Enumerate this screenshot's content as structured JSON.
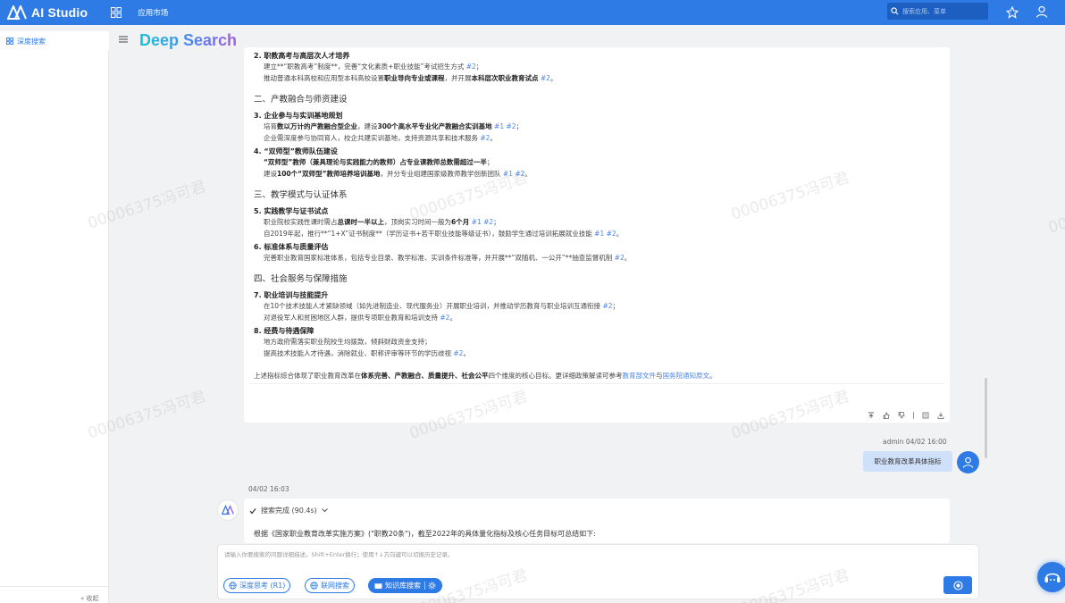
{
  "topbar": {
    "brand": "AI Studio",
    "app_market": "应用市场",
    "search_placeholder": "搜索应用、菜单"
  },
  "sidebar": {
    "items": [
      {
        "label": "深度搜索"
      }
    ],
    "collapse_label": "收起"
  },
  "header": {
    "title": "Deep Search"
  },
  "answer": {
    "items": [
      {
        "title": "2. 职教高考与高层次人才培养",
        "lines": [
          [
            {
              "t": "建立**“职教高考”制度**，完善“文化素质+职业技能”考试招生方式 "
            },
            {
              "t": "#2",
              "c": 1
            },
            {
              "t": "；"
            }
          ],
          [
            {
              "t": "推动普通本科高校和应用型本科高校设置"
            },
            {
              "t": "职业导向专业或课程",
              "b": 1
            },
            {
              "t": "，并开展"
            },
            {
              "t": "本科层次职业教育试点",
              "b": 1
            },
            {
              "t": " "
            },
            {
              "t": "#2",
              "c": 1
            },
            {
              "t": "。"
            }
          ]
        ]
      },
      {
        "section": "二、产教融合与师资建设"
      },
      {
        "title": "3. 企业参与与实训基地规划",
        "lines": [
          [
            {
              "t": "培育"
            },
            {
              "t": "数以万计的产教融合型企业",
              "b": 1
            },
            {
              "t": "，建设"
            },
            {
              "t": "300个高水平专业化产教融合实训基地",
              "b": 1
            },
            {
              "t": " "
            },
            {
              "t": "#1",
              "c": 1
            },
            {
              "t": " "
            },
            {
              "t": "#2",
              "c": 1
            },
            {
              "t": "；"
            }
          ],
          [
            {
              "t": "企业需深度参与协同育人，校企共建实训基地，支持资源共享和技术服务 "
            },
            {
              "t": "#2",
              "c": 1
            },
            {
              "t": "。"
            }
          ]
        ]
      },
      {
        "title": "4. “双师型”教师队伍建设",
        "lines": [
          [
            {
              "t": "“双师型”教师（兼具理论与实践能力的教师）占专业课教师总数需超过一半",
              "b": 1
            },
            {
              "t": "；"
            }
          ],
          [
            {
              "t": "建设"
            },
            {
              "t": "100个“双师型”教师培养培训基地",
              "b": 1
            },
            {
              "t": "，并分专业组建国家级教师教学创新团队 "
            },
            {
              "t": "#1",
              "c": 1
            },
            {
              "t": " "
            },
            {
              "t": "#2",
              "c": 1
            },
            {
              "t": "。"
            }
          ]
        ]
      },
      {
        "section": "三、教学模式与认证体系"
      },
      {
        "title": "5. 实践教学与证书试点",
        "lines": [
          [
            {
              "t": "职业院校实践性课时需占"
            },
            {
              "t": "总课时一半以上",
              "b": 1
            },
            {
              "t": "，顶岗实习时间一般为"
            },
            {
              "t": "6个月",
              "b": 1
            },
            {
              "t": " "
            },
            {
              "t": "#1",
              "c": 1
            },
            {
              "t": " "
            },
            {
              "t": "#2",
              "c": 1
            },
            {
              "t": "；"
            }
          ],
          [
            {
              "t": "自2019年起，推行**“1+X”证书制度**（学历证书+若干职业技能等级证书），鼓励学生通过培训拓展就业技能 "
            },
            {
              "t": "#1",
              "c": 1
            },
            {
              "t": " "
            },
            {
              "t": "#2",
              "c": 1
            },
            {
              "t": "。"
            }
          ]
        ]
      },
      {
        "title": "6. 标准体系与质量评估",
        "lines": [
          [
            {
              "t": "完善职业教育国家标准体系，包括专业目录、教学标准、实训条件标准等，并开展**“双随机、一公开”**抽查监督机制 "
            },
            {
              "t": "#2",
              "c": 1
            },
            {
              "t": "。"
            }
          ]
        ]
      },
      {
        "section": "四、社会服务与保障措施"
      },
      {
        "title": "7. 职业培训与技能提升",
        "lines": [
          [
            {
              "t": "在10个技术技能人才紧缺领域（如先进制造业、现代服务业）开展职业培训，并推动学历教育与职业培训互通衔接 "
            },
            {
              "t": "#2",
              "c": 1
            },
            {
              "t": "；"
            }
          ],
          [
            {
              "t": "对退役军人和贫困地区人群，提供专项职业教育和培训支持 "
            },
            {
              "t": "#2",
              "c": 1
            },
            {
              "t": "。"
            }
          ]
        ]
      },
      {
        "title": "8. 经费与待遇保障",
        "lines": [
          [
            {
              "t": "地方政府需落实职业院校生均拨款，倾斜财政资金支持；"
            }
          ],
          [
            {
              "t": "提高技术技能人才待遇，消除就业、职称评审等环节的学历歧视 "
            },
            {
              "t": "#2",
              "c": 1
            },
            {
              "t": "。"
            }
          ]
        ]
      }
    ],
    "summary": [
      {
        "t": "上述指标综合体现了职业教育改革在"
      },
      {
        "t": "体系完善、产教融合、质量提升、社会公平",
        "b": 1
      },
      {
        "t": "四个维度的核心目标。更详细政策解读可参考"
      },
      {
        "t": "教育部文件",
        "l": 1
      },
      {
        "t": "与"
      },
      {
        "t": "国务院通知原文",
        "l": 1
      },
      {
        "t": "。"
      }
    ]
  },
  "user_message": {
    "meta": "admin 04/02 16:00",
    "text": "职业教育改革具体指标"
  },
  "bot_reply": {
    "time": "04/02 16:03",
    "status": "搜索完成 (90.4s)",
    "text": "根据《国家职业教育改革实施方案》(\"职教20条\")，截至2022年的具体量化指标及核心任务目标可总结如下:"
  },
  "input": {
    "placeholder": "请输入你要搜索的问题详细描述。Shift+Enter换行；使用↑↓方向键可以切换历史记录。",
    "chips": {
      "deep_think": "深度思考 (R1)",
      "web_search": "联网搜索",
      "kb_search": "知识库搜索"
    }
  },
  "watermark": "00006375冯可君",
  "colors": {
    "primary": "#2f7be6",
    "citation": "#4a86e8"
  },
  "icons": [
    "apps-grid-icon",
    "search-icon",
    "star-icon",
    "user-icon",
    "grid-icon",
    "menu-icon",
    "check-icon",
    "chevron-down-icon",
    "globe-icon",
    "book-icon",
    "gear-icon",
    "send-icon",
    "assistant-icon"
  ]
}
